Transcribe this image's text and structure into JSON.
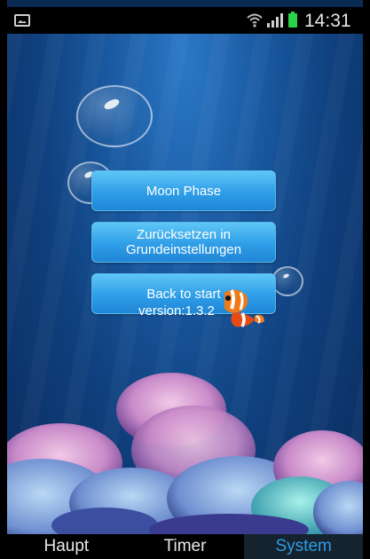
{
  "status_bar": {
    "time": "14:31"
  },
  "menu": {
    "moon_phase": "Moon Phase",
    "reset_line1": "Zurücksetzen in",
    "reset_line2": "Grundeinstellungen",
    "back_to_start": "Back to start"
  },
  "version_text": "version:1.3.2",
  "tabs": [
    {
      "label": "Haupt",
      "active": false
    },
    {
      "label": "Timer",
      "active": false
    },
    {
      "label": "System",
      "active": true
    }
  ],
  "colors": {
    "accent": "#2f9de5",
    "button": "#3aa8ee",
    "battery": "#2bd34a"
  }
}
